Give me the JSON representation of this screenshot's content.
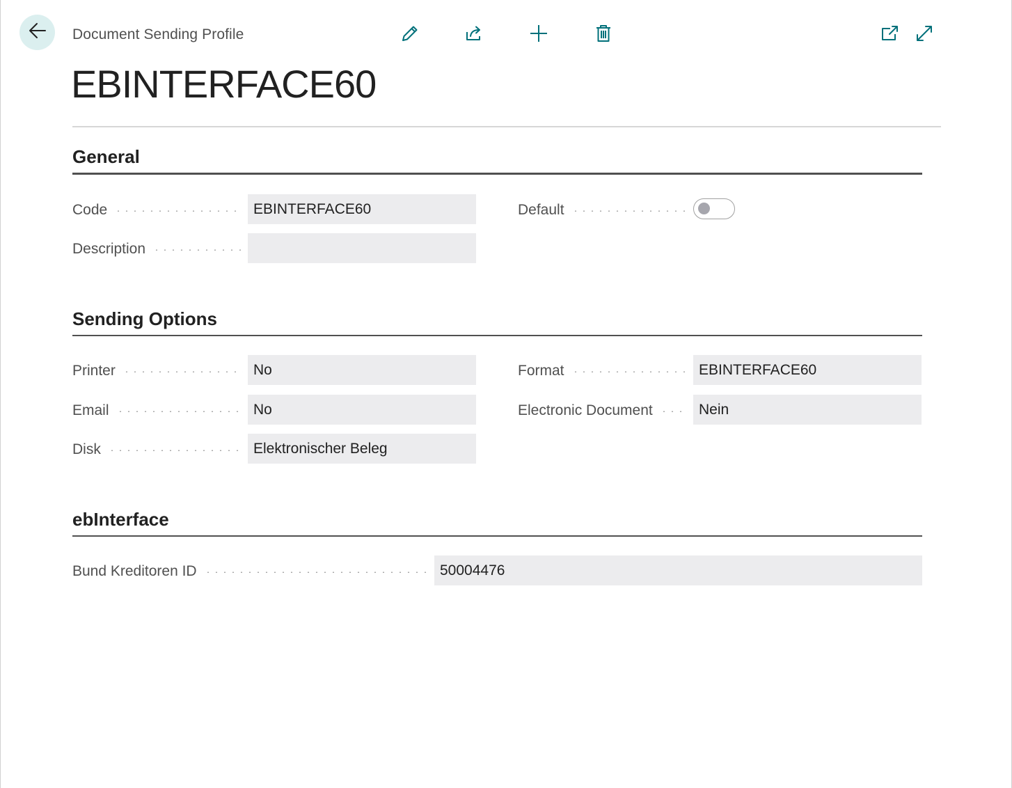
{
  "header": {
    "breadcrumb": "Document Sending Profile",
    "title": "EBINTERFACE60",
    "icons": {
      "back": "arrow-left-icon",
      "edit": "pencil-icon",
      "share": "share-icon",
      "new": "plus-icon",
      "delete": "trash-icon",
      "open_new_window": "open-in-new-window-icon",
      "expand": "expand-icon"
    },
    "accent_color": "#00707a"
  },
  "general": {
    "title": "General",
    "code": {
      "label": "Code",
      "value": "EBINTERFACE60"
    },
    "description": {
      "label": "Description",
      "value": ""
    },
    "default": {
      "label": "Default",
      "checked": false
    }
  },
  "sending_options": {
    "title": "Sending Options",
    "printer": {
      "label": "Printer",
      "value": "No"
    },
    "email": {
      "label": "Email",
      "value": "No"
    },
    "disk": {
      "label": "Disk",
      "value": "Elektronischer Beleg"
    },
    "format": {
      "label": "Format",
      "value": "EBINTERFACE60"
    },
    "electronic_document": {
      "label": "Electronic Document",
      "value": "Nein"
    }
  },
  "ebinterface": {
    "title": "ebInterface",
    "bund_kreditoren_id": {
      "label": "Bund Kreditoren ID",
      "value": "50004476"
    }
  }
}
